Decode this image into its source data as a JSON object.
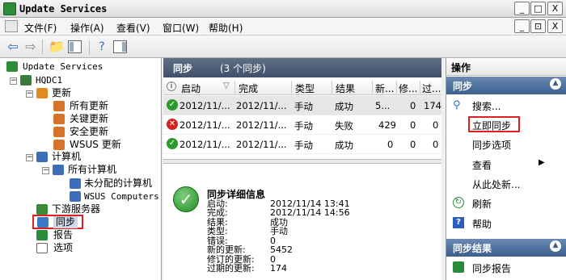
{
  "window": {
    "title": "Update Services"
  },
  "menu": [
    "文件(F)",
    "操作(A)",
    "查看(V)",
    "窗口(W)",
    "帮助(H)"
  ],
  "window_controls": {
    "min": "_",
    "max": "□",
    "close": "X",
    "inner_min": "_",
    "inner_max": "⊡",
    "inner_close": "X"
  },
  "tree": {
    "root": "Update Services",
    "server": "HQDC1",
    "updates": "更新",
    "all_updates": "所有更新",
    "critical_updates": "关键更新",
    "security_updates": "安全更新",
    "wsus_updates": "WSUS 更新",
    "computers": "计算机",
    "all_computers": "所有计算机",
    "unassigned": "未分配的计算机",
    "wsus_computers": "WSUS Computers",
    "downstream": "下游服务器",
    "sync": "同步",
    "reports": "报告",
    "options": "选项"
  },
  "main": {
    "title": "同步",
    "count": "(3 个同步)",
    "columns": [
      "启动",
      "完成",
      "类型",
      "结果",
      "新...",
      "修...",
      "过..."
    ],
    "rows": [
      {
        "start": "2012/11/...",
        "end": "2012/11/...",
        "type": "手动",
        "result": "成功",
        "new": "5...",
        "rev": "0",
        "exp": "174",
        "status": "success"
      },
      {
        "start": "2012/11/...",
        "end": "2012/11/...",
        "type": "手动",
        "result": "失败",
        "new": "429",
        "rev": "0",
        "exp": "0",
        "status": "fail"
      },
      {
        "start": "2012/11/...",
        "end": "2012/11/...",
        "type": "手动",
        "result": "成功",
        "new": "0",
        "rev": "0",
        "exp": "0",
        "status": "success"
      }
    ]
  },
  "detail": {
    "title": "同步详细信息",
    "fields": [
      {
        "label": "启动:",
        "value": "2012/11/14 13:41"
      },
      {
        "label": "完成:",
        "value": "2012/11/14 14:56"
      },
      {
        "label": "结果:",
        "value": "成功"
      },
      {
        "label": "类型:",
        "value": "手动"
      },
      {
        "label": "错误:",
        "value": "0"
      },
      {
        "label": "新的更新:",
        "value": "5452"
      },
      {
        "label": "修订的更新:",
        "value": "0"
      },
      {
        "label": "过期的更新:",
        "value": "174"
      }
    ]
  },
  "actions": {
    "header": "操作",
    "section1": "同步",
    "search": "搜索...",
    "sync_now": "立即同步",
    "sync_options": "同步选项",
    "view": "查看",
    "new_window": "从此处新...",
    "refresh": "刷新",
    "help": "帮助",
    "section2": "同步结果",
    "sync_report": "同步报告"
  },
  "colors": {
    "accent_red": "#e02020",
    "success": "#2a9a2a",
    "fail": "#d42020",
    "section_blue": "#4a6c9a"
  }
}
